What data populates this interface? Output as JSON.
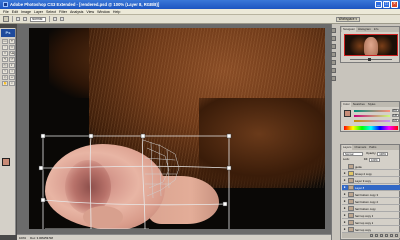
{
  "window": {
    "title": "Adobe Photoshop CS3 Extended - [rendered.psd @ 100% (Layer 8, RGB/8)]",
    "app_logo": "Ps",
    "buttons": [
      "_",
      "□",
      "×"
    ]
  },
  "menu": [
    "File",
    "Edit",
    "Image",
    "Layer",
    "Select",
    "Filter",
    "Analysis",
    "View",
    "Window",
    "Help"
  ],
  "options_bar": {
    "mode_field": "Normal",
    "workspace_label": "Workspace ▾"
  },
  "toolbox": {
    "tools": [
      "▭",
      "⌖",
      "◌",
      "⤧",
      "⌗",
      "⌫",
      "✎",
      "✑",
      "⎘",
      "◐",
      "⌁",
      "T",
      "◇",
      "▱",
      "✋",
      "⌕"
    ]
  },
  "panels": {
    "navigator": {
      "tabs": [
        "Navigator",
        "Histogram",
        "Info"
      ]
    },
    "color": {
      "tabs": [
        "Color",
        "Swatches",
        "Styles"
      ],
      "channels": [
        {
          "label": "R",
          "value": "201"
        },
        {
          "label": "G",
          "value": "142"
        },
        {
          "label": "B",
          "value": "121"
        }
      ],
      "swatch_color": "#c98e79"
    },
    "layers": {
      "tabs": [
        "Layers",
        "Channels",
        "Paths"
      ],
      "blend_mode": "Normal",
      "opacity_label": "Opacity:",
      "opacity_value": "100%",
      "lock_label": "Lock:",
      "fill_label": "Fill:",
      "fill_value": "100%",
      "items": [
        {
          "name": "guide",
          "type": "layer",
          "selected": false,
          "visible": false
        },
        {
          "name": "Group 2 copy",
          "type": "group",
          "selected": false,
          "visible": true
        },
        {
          "name": "Layer 9 copy",
          "type": "layer",
          "selected": false,
          "visible": true
        },
        {
          "name": "Layer 8",
          "type": "layer",
          "selected": true,
          "visible": true
        },
        {
          "name": "hair bottom copy 3",
          "type": "layer",
          "selected": false,
          "visible": true
        },
        {
          "name": "hair bottom copy 2",
          "type": "layer",
          "selected": false,
          "visible": true
        },
        {
          "name": "hair bottom copy",
          "type": "layer",
          "selected": false,
          "visible": true
        },
        {
          "name": "hair top copy 3",
          "type": "layer",
          "selected": false,
          "visible": true
        },
        {
          "name": "hair top copy 2",
          "type": "layer",
          "selected": false,
          "visible": true
        },
        {
          "name": "hair top copy",
          "type": "layer",
          "selected": false,
          "visible": true
        }
      ]
    }
  },
  "status": {
    "zoom": "100%",
    "doc": "Doc: 3.00M/59.5M"
  },
  "colors": {
    "titlebar": "#1d55c0",
    "selected_layer": "#3168c6",
    "foreground": "#c88a76"
  }
}
